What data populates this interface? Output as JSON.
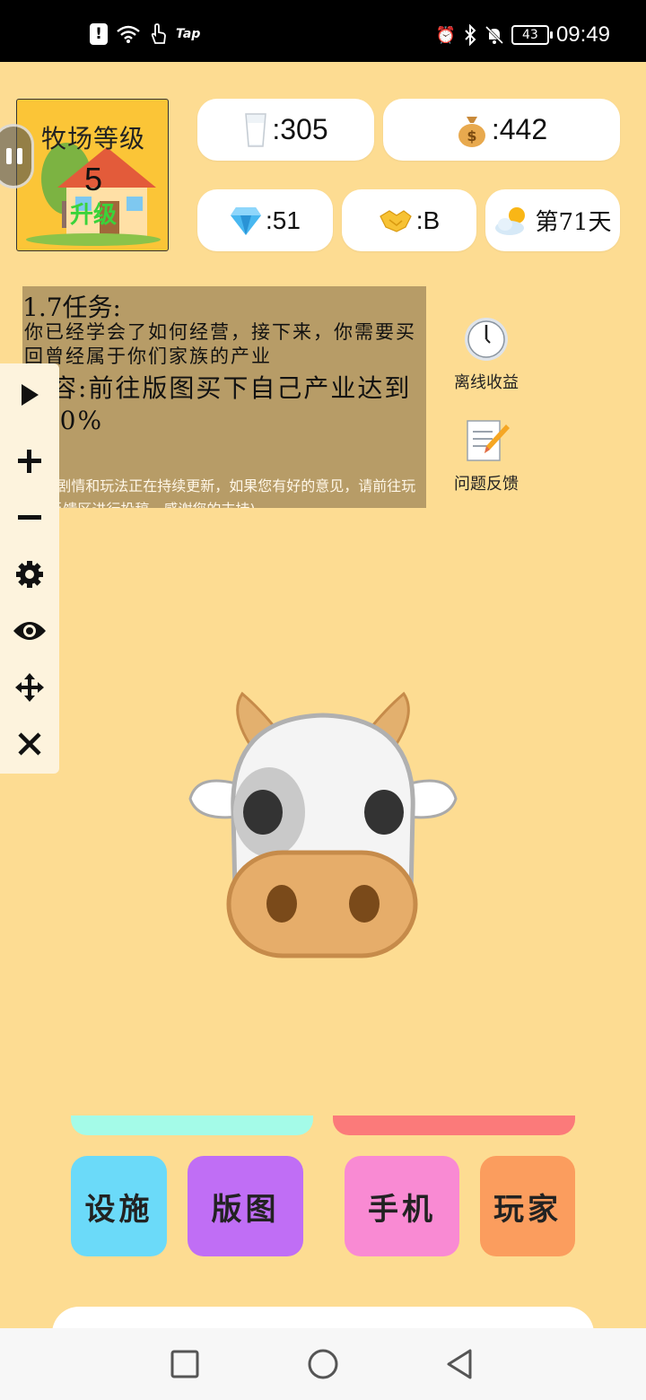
{
  "status_bar": {
    "tap_label": "Tap",
    "battery": "43",
    "time": "09:49"
  },
  "ranch": {
    "title": "牧场等级",
    "level": "5",
    "upgrade_label": "升级"
  },
  "stats": {
    "milk": ":305",
    "money": ":442",
    "diamond": ":51",
    "reputation": ":B",
    "day": "第71天"
  },
  "task": {
    "title": "1.7任务:",
    "description": "你已经学会了如何经营，接下来，你需要买回曾经属于你们家族的产业",
    "content": "内容:前往版图买下自己产业达到100%",
    "note": "(游戏剧情和玩法正在持续更新，如果您有好的意见，请前往玩家>反馈区进行投稿，感谢您的支持)"
  },
  "side_buttons": {
    "offline_income": "离线收益",
    "feedback": "问题反馈"
  },
  "bottom_buttons": {
    "facilities": "设施",
    "map": "版图",
    "phone": "手机",
    "player": "玩家"
  },
  "colors": {
    "background": "#fddc92",
    "facilities": "#6bdaf9",
    "map": "#c06ef5",
    "phone": "#f98ad3",
    "player": "#fb9d5e"
  }
}
